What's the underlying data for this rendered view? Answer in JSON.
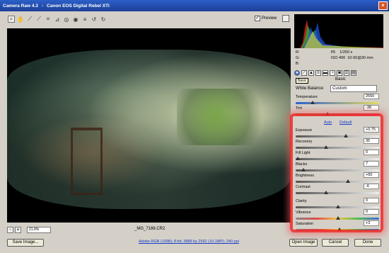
{
  "window": {
    "app": "Camera Raw 4.3",
    "camera": "Canon EOS Digital Rebel XTi"
  },
  "toolbar": {
    "preview_label": "Preview",
    "preview_checked": true
  },
  "bottom": {
    "zoom": "21.8%",
    "filename": "_MG_7188.CR2"
  },
  "buttons": {
    "save": "Save Image...",
    "open": "Open Image",
    "cancel": "Cancel",
    "done": "Done"
  },
  "workflow_link": "Adobe RGB (1998); 8 bit; 3888 by 2592 (10.1MP); 240 ppi",
  "info": {
    "r": "R:",
    "g": "G:",
    "b": "B:",
    "aperture": "f/5",
    "shutter": "1/250 s",
    "iso": "ISO 400",
    "lens": "10-50@30 mm"
  },
  "panel": {
    "tab_tooltip": "Basic",
    "section_title": "Basic",
    "white_balance_label": "White Balance:",
    "white_balance_value": "Custom",
    "auto": "Auto",
    "default": "Default",
    "controls": [
      {
        "label": "Temperature",
        "value": "2550",
        "pos": 0.18,
        "track": "temp"
      },
      {
        "label": "Tint",
        "value": "-38",
        "pos": 0.37,
        "track": "tint"
      },
      {
        "label": "Exposure",
        "value": "+0.75",
        "pos": 0.6,
        "track": "gray"
      },
      {
        "label": "Recovery",
        "value": "35",
        "pos": 0.35,
        "track": "gray"
      },
      {
        "label": "Fill Light",
        "value": "0",
        "pos": 0.0,
        "track": "gray"
      },
      {
        "label": "Blacks",
        "value": "7",
        "pos": 0.07,
        "track": "gray"
      },
      {
        "label": "Brightness",
        "value": "+50",
        "pos": 0.62,
        "track": "gray"
      },
      {
        "label": "Contrast",
        "value": "-6",
        "pos": 0.35,
        "track": "gray"
      },
      {
        "label": "Clarity",
        "value": "0",
        "pos": 0.5,
        "track": "gray"
      },
      {
        "label": "Vibrance",
        "value": "0",
        "pos": 0.5,
        "track": "sat"
      },
      {
        "label": "Saturation",
        "value": "+3",
        "pos": 0.52,
        "track": "sat"
      }
    ]
  }
}
